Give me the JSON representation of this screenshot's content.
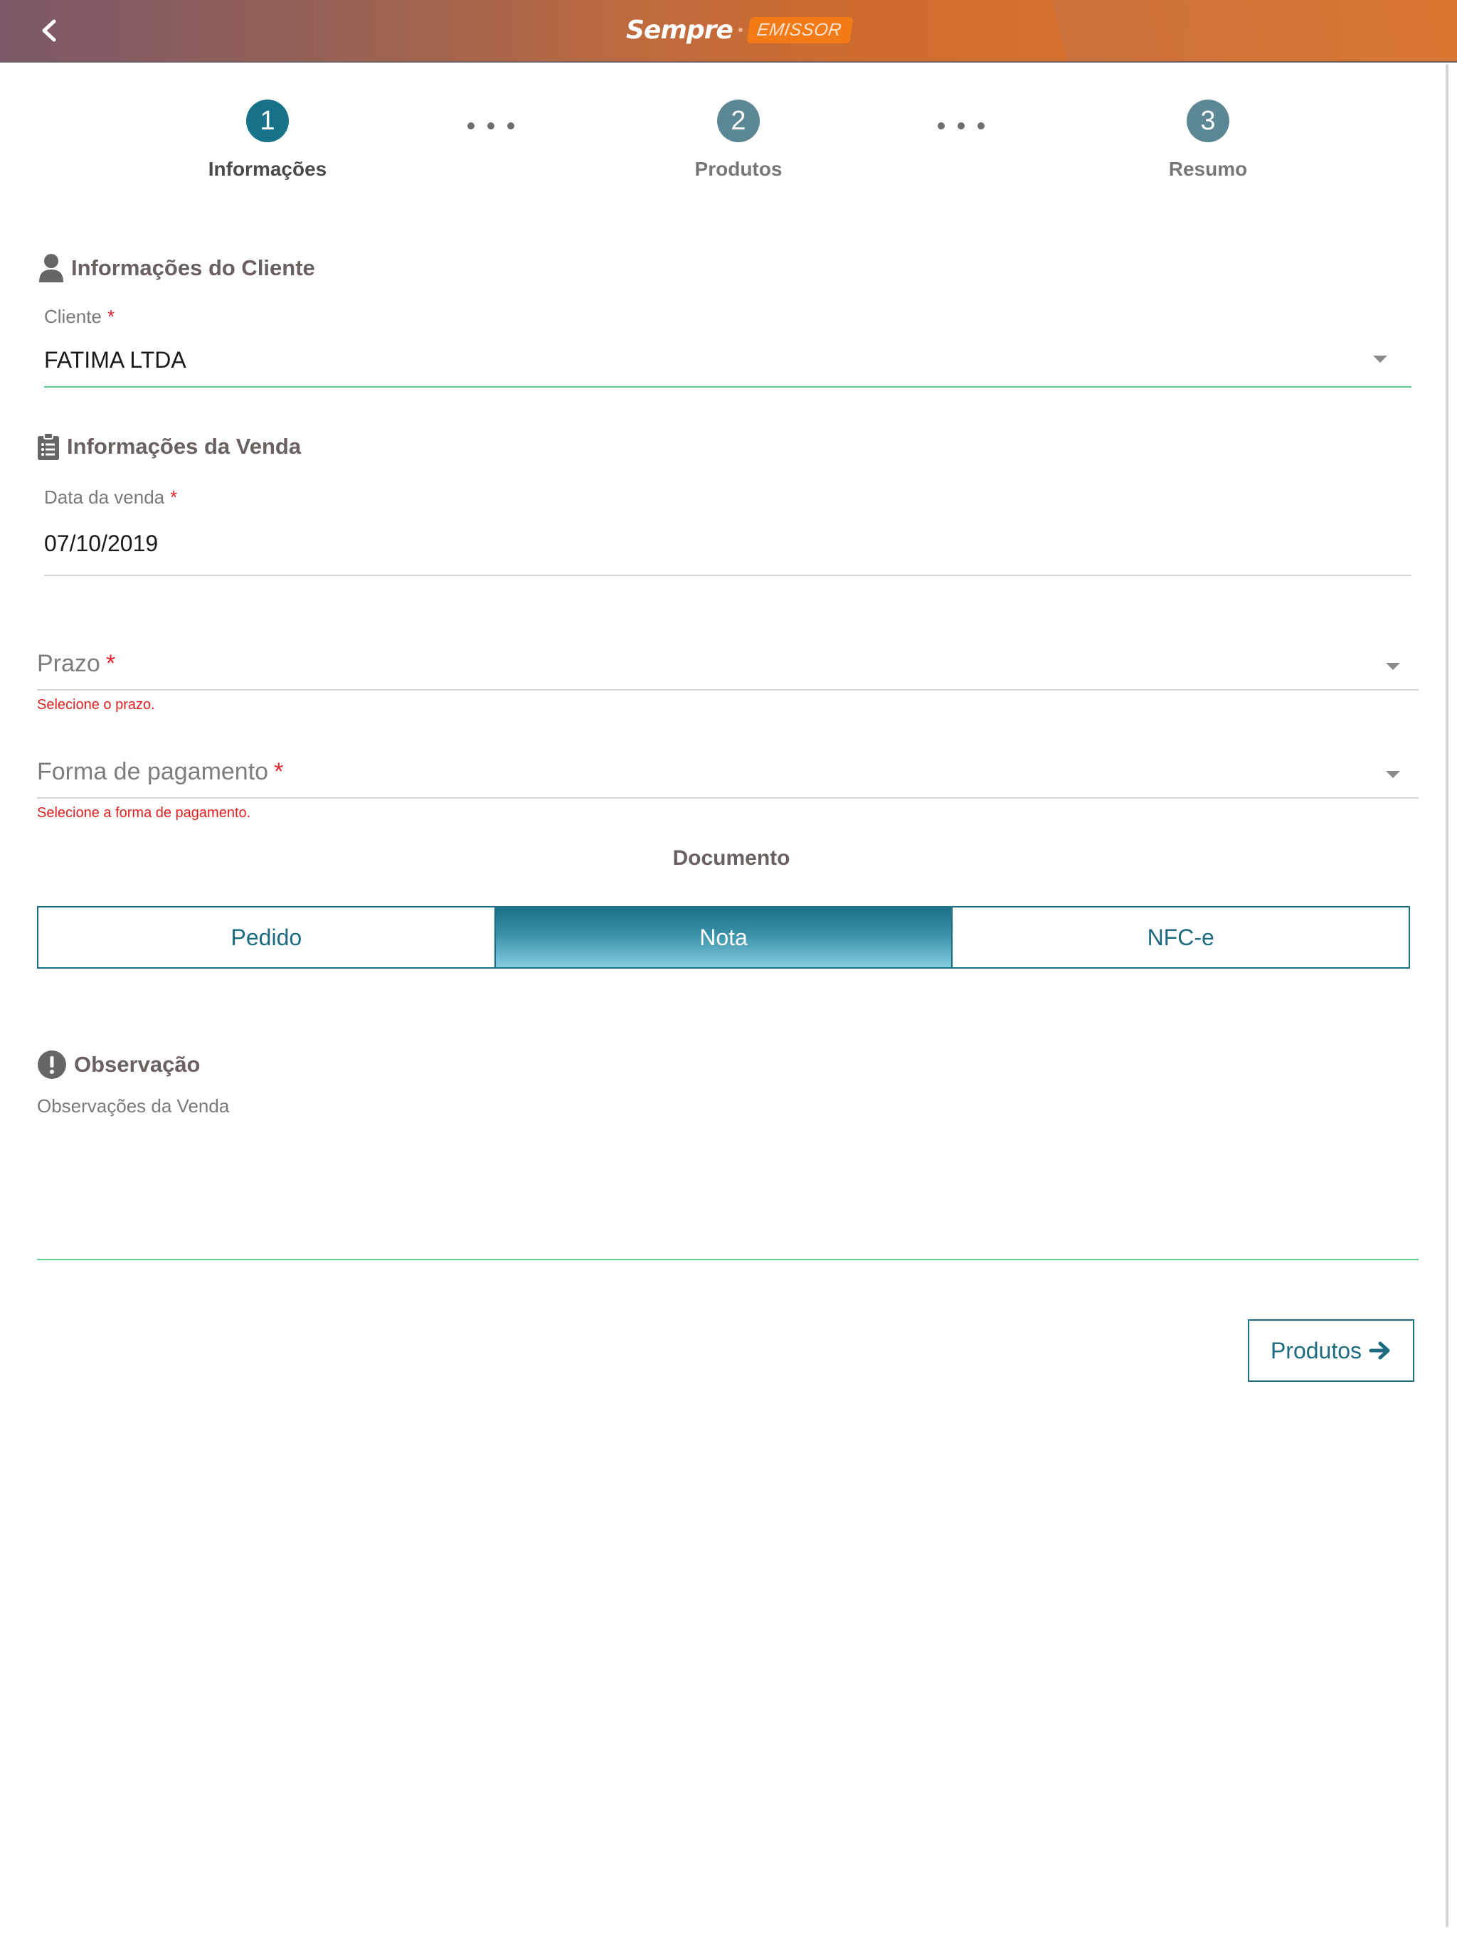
{
  "header": {
    "logo_main": "Sempre",
    "logo_badge": "EMISSOR"
  },
  "stepper": {
    "steps": [
      {
        "number": "1",
        "label": "Informações",
        "state": "active"
      },
      {
        "number": "2",
        "label": "Produtos",
        "state": "inactive"
      },
      {
        "number": "3",
        "label": "Resumo",
        "state": "inactive"
      }
    ]
  },
  "cliente_section": {
    "title": "Informações do Cliente",
    "icon": "user-icon",
    "cliente_label": "Cliente",
    "required_mark": "*",
    "cliente_value": "FATIMA LTDA"
  },
  "venda_section": {
    "title": "Informações da Venda",
    "icon": "clipboard-list-icon",
    "data_label": "Data da venda",
    "required_mark": "*",
    "data_value": "07/10/2019",
    "prazo_placeholder": "Prazo",
    "prazo_error": "Selecione o prazo.",
    "pagamento_placeholder": "Forma de pagamento",
    "pagamento_error": "Selecione a forma de pagamento."
  },
  "documento": {
    "title": "Documento",
    "options": [
      "Pedido",
      "Nota",
      "NFC-e"
    ],
    "selected": "Nota"
  },
  "observacao": {
    "title": "Observação",
    "icon": "exclamation-circle-icon",
    "placeholder": "Observações da Venda"
  },
  "actions": {
    "next_label": "Produtos"
  },
  "colors": {
    "primary": "#17738a",
    "error": "#e02020",
    "focus_underline": "#5ccf8c",
    "header_orange": "#e17f2f"
  }
}
